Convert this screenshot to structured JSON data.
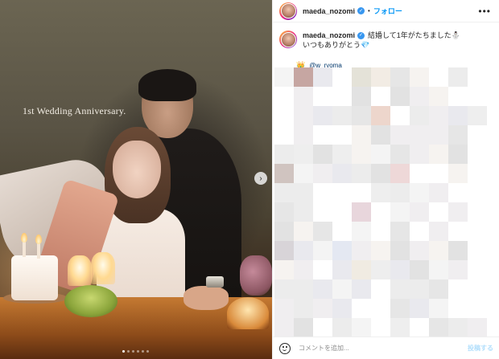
{
  "photo": {
    "overlay_text": "1st Wedding Anniversary.",
    "carousel_dots": 6,
    "active_dot": 0,
    "next_glyph": "›"
  },
  "header": {
    "username": "maeda_nozomi",
    "bullet": "•",
    "follow_label": "フォロー",
    "more_glyph": "•••"
  },
  "post": {
    "username": "maeda_nozomi",
    "caption_line1": "結婚して1年がたちました",
    "caption_emoji1": "⛄",
    "caption_line2": "いつもありがとう",
    "caption_emoji2": "💎",
    "mention_icon": "👑",
    "mention": "@w_ryoma"
  },
  "composer": {
    "placeholder": "コメントを追加...",
    "post_label": "投稿する"
  },
  "colors": {
    "accent": "#0095f6",
    "verified": "#3897f0",
    "post_disabled": "#b2dffc"
  }
}
